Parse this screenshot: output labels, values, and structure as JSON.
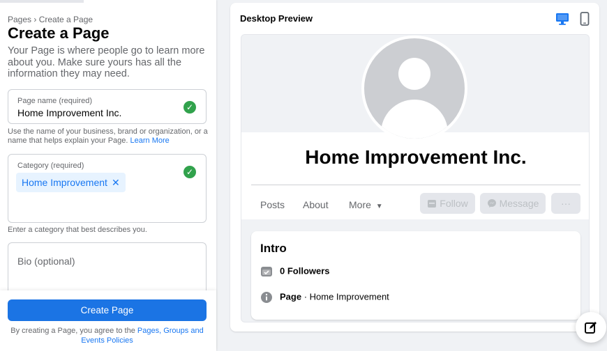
{
  "left": {
    "breadcrumb": "Pages › Create a Page",
    "title": "Create a Page",
    "intro": "Your Page is where people go to learn more about you. Make sure yours has all the information they may need.",
    "page_name": {
      "label": "Page name (required)",
      "value": "Home Improvement Inc.",
      "help": "Use the name of your business, brand or organization, or a name that helps explain your Page.",
      "help_link": "Learn More"
    },
    "category": {
      "label": "Category (required)",
      "chip": "Home Improvement",
      "help": "Enter a category that best describes you."
    },
    "bio": {
      "placeholder": "Bio (optional)"
    },
    "create_button": "Create Page",
    "terms_prefix": "By creating a Page, you agree to the",
    "terms_link": "Pages, Groups and Events Policies"
  },
  "preview": {
    "title": "Desktop Preview",
    "page_name": "Home Improvement Inc.",
    "tabs": [
      "Posts",
      "About",
      "More"
    ],
    "actions": {
      "follow": "Follow",
      "message": "Message",
      "more": "···"
    },
    "intro": {
      "title": "Intro",
      "followers": "0 Followers",
      "page_label": "Page",
      "page_category": " · Home Improvement"
    }
  },
  "colors": {
    "accent": "#1877f2",
    "success": "#31a24c",
    "button": "#1b74e4"
  },
  "icons": [
    "desktop-icon",
    "mobile-icon",
    "check-icon",
    "close-icon",
    "caret-down-icon",
    "follow-icon",
    "messenger-icon",
    "followers-icon",
    "info-icon",
    "edit-icon"
  ]
}
